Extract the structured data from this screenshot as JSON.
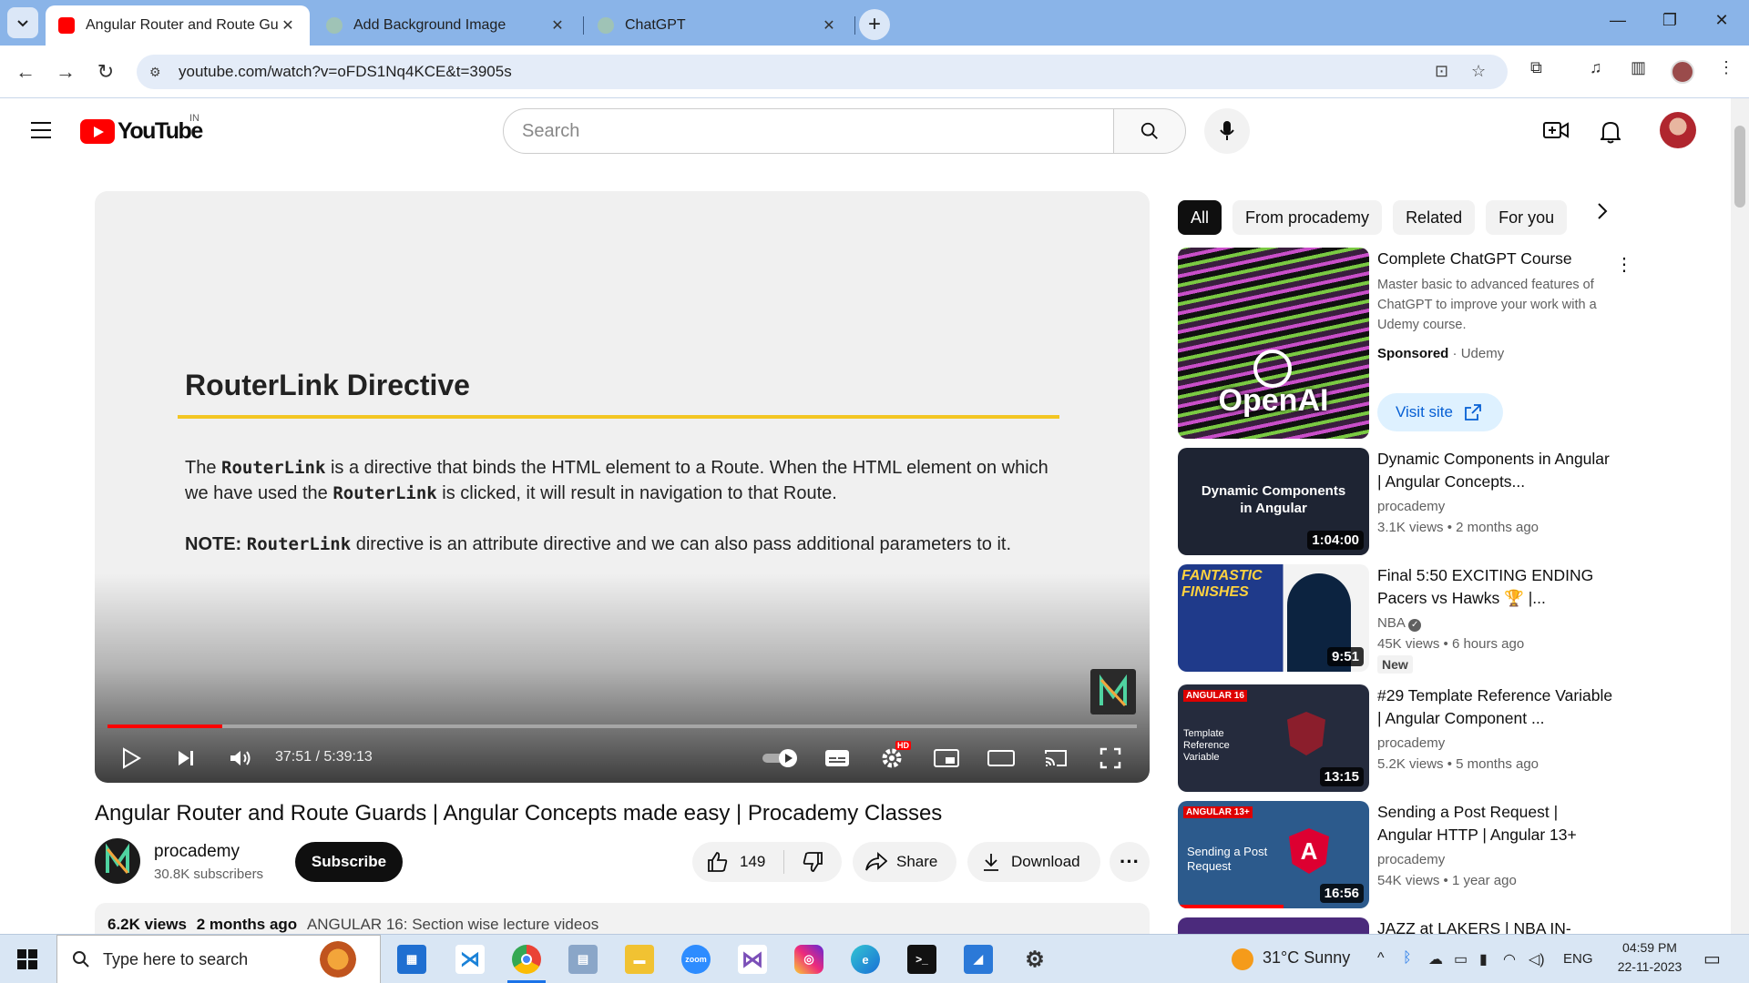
{
  "browser": {
    "tabs": [
      {
        "title": "Angular Router and Route Gua",
        "favicon_color": "#ff0000",
        "active": true
      },
      {
        "title": "Add Background Image",
        "favicon_color": "#10a37f",
        "active": false
      },
      {
        "title": "ChatGPT",
        "favicon_color": "#10a37f",
        "active": false
      }
    ],
    "url": "youtube.com/watch?v=oFDS1Nq4KCE&t=3905s"
  },
  "youtube": {
    "logo_text": "YouTube",
    "country_code": "IN",
    "search_placeholder": "Search"
  },
  "player": {
    "slide": {
      "title": "RouterLink Directive",
      "para1_prefix": "The ",
      "para1_code": "RouterLink",
      "para1_mid": " is a directive that binds the HTML element to a Route. When the HTML element on which we have used the ",
      "para1_code2": "RouterLink",
      "para1_suffix": " is clicked, it will result in navigation to that Route.",
      "note_label": "NOTE: ",
      "note_code": "RouterLink",
      "note_suffix": " directive is an attribute directive and we can also pass additional parameters to it."
    },
    "time": "37:51 / 5:39:13",
    "progress_fraction": 0.1116,
    "hd_badge": "HD"
  },
  "video": {
    "title": "Angular Router and Route Guards | Angular Concepts made easy | Procademy Classes",
    "channel": "procademy",
    "subscribers": "30.8K subscribers",
    "subscribe_label": "Subscribe",
    "likes": "149",
    "share_label": "Share",
    "download_label": "Download",
    "views": "6.2K views",
    "age": "2 months ago",
    "playlist_tag": "ANGULAR 16: Section wise lecture videos"
  },
  "sidebar": {
    "chips": [
      "All",
      "From procademy",
      "Related",
      "For you"
    ],
    "ad": {
      "title": "Complete ChatGPT Course",
      "description": "Master basic to advanced features of ChatGPT to improve your work with a Udemy course.",
      "sponsored": "Sponsored",
      "advertiser": "Udemy",
      "visit_label": "Visit site",
      "thumb_text": "OpenAI"
    },
    "recs": [
      {
        "title": "Dynamic Components in Angular | Angular Concepts...",
        "channel": "procademy",
        "meta": "3.1K views • 2 months ago",
        "duration": "1:04:00",
        "thumb_text": "Dynamic Components in Angular"
      },
      {
        "title": "Final 5:50 EXCITING ENDING Pacers vs Hawks 🏆 |...",
        "channel": "NBA",
        "meta": "45K views • 6 hours ago",
        "duration": "9:51",
        "badge": "New",
        "thumb_text": "FANTASTIC FINISHES"
      },
      {
        "title": "#29 Template Reference Variable | Angular Component ...",
        "channel": "procademy",
        "meta": "5.2K views • 5 months ago",
        "duration": "13:15",
        "thumb_text": "Template Reference Variable"
      },
      {
        "title": "Sending a Post Request | Angular HTTP | Angular 13+",
        "channel": "procademy",
        "meta": "54K views • 1 year ago",
        "duration": "16:56",
        "thumb_text": "Sending a Post Request"
      },
      {
        "title": "JAZZ at LAKERS | NBA IN-",
        "channel": "",
        "meta": "",
        "duration": ""
      }
    ]
  },
  "taskbar": {
    "search_placeholder": "Type here to search",
    "weather": "31°C  Sunny",
    "lang": "ENG",
    "time": "04:59 PM",
    "date": "22-11-2023"
  }
}
